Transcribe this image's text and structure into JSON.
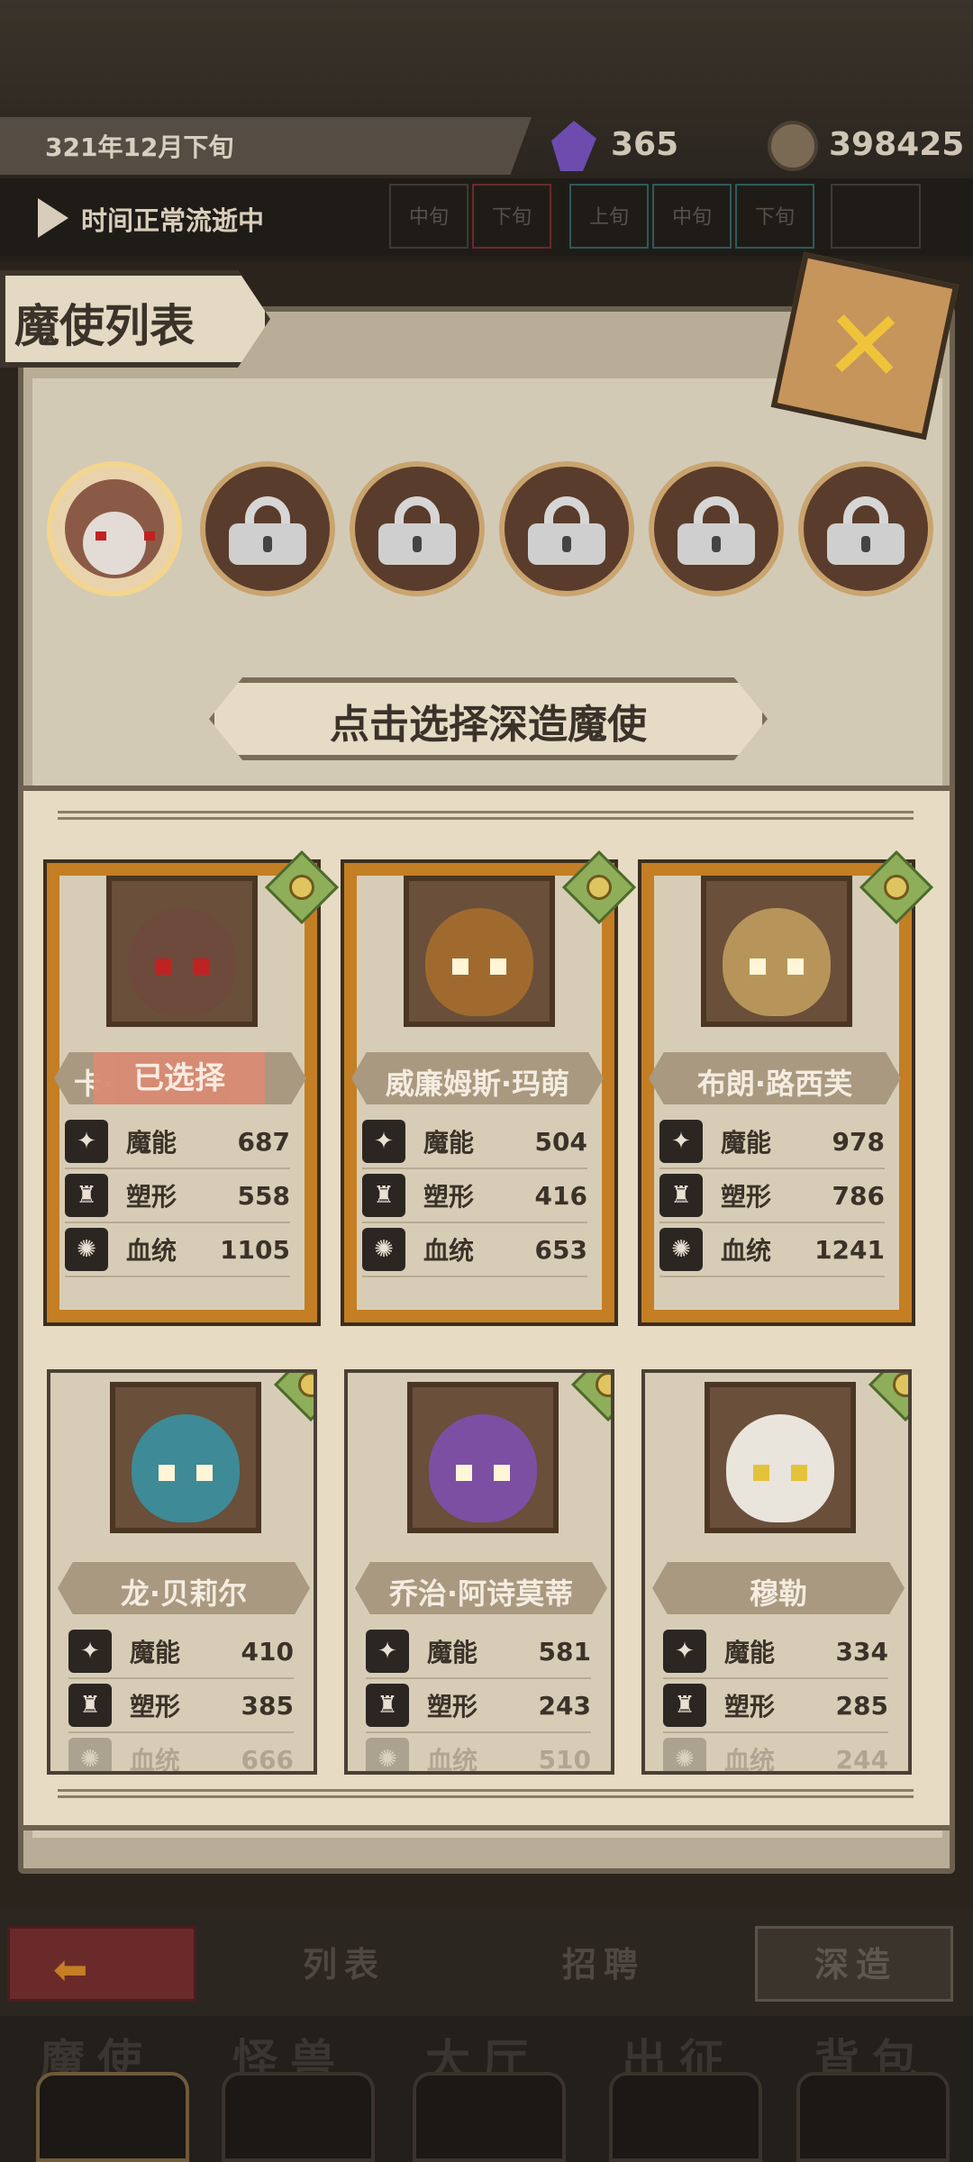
{
  "top": {
    "date": "321年12月下旬",
    "gems": "365",
    "coins": "398425",
    "time_status": "时间正常流逝中",
    "time_cells": [
      "中旬",
      "下旬",
      "上旬",
      "中旬",
      "下旬",
      "—"
    ]
  },
  "panel": {
    "title": "魔使列表",
    "select_prompt": "点击选择深造魔使"
  },
  "cards": [
    {
      "name": "卡·",
      "selected_label": "已选择",
      "stats": [
        {
          "label": "魔能",
          "value": "687"
        },
        {
          "label": "塑形",
          "value": "558"
        },
        {
          "label": "血统",
          "value": "1105"
        }
      ]
    },
    {
      "name": "威廉姆斯·玛萌",
      "stats": [
        {
          "label": "魔能",
          "value": "504"
        },
        {
          "label": "塑形",
          "value": "416"
        },
        {
          "label": "血统",
          "value": "653"
        }
      ]
    },
    {
      "name": "布朗·路西芙",
      "stats": [
        {
          "label": "魔能",
          "value": "978"
        },
        {
          "label": "塑形",
          "value": "786"
        },
        {
          "label": "血统",
          "value": "1241"
        }
      ]
    },
    {
      "name": "龙·贝莉尔",
      "stats": [
        {
          "label": "魔能",
          "value": "410"
        },
        {
          "label": "塑形",
          "value": "385"
        },
        {
          "label": "血统",
          "value": "666"
        }
      ]
    },
    {
      "name": "乔治·阿诗莫蒂",
      "stats": [
        {
          "label": "魔能",
          "value": "581"
        },
        {
          "label": "塑形",
          "value": "243"
        },
        {
          "label": "血统",
          "value": "510"
        }
      ]
    },
    {
      "name": "穆勒",
      "stats": [
        {
          "label": "魔能",
          "value": "334"
        },
        {
          "label": "塑形",
          "value": "285"
        },
        {
          "label": "血统",
          "value": "244"
        }
      ]
    }
  ],
  "tabs": {
    "list": "列表",
    "recruit": "招聘",
    "study": "深造"
  },
  "nav": [
    "魔使",
    "怪兽",
    "大厅",
    "出征",
    "背包"
  ],
  "colors": {
    "accent": "#c47e24",
    "panel": "#d3cab6",
    "dark": "#2b2620"
  }
}
